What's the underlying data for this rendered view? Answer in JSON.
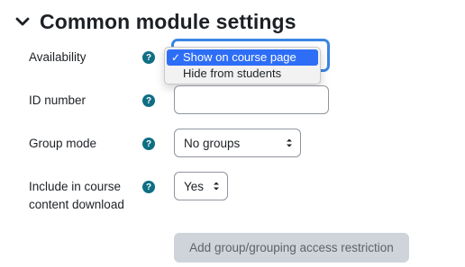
{
  "section": {
    "title": "Common module settings"
  },
  "availability": {
    "label": "Availability",
    "options": [
      "Show on course page",
      "Hide from students"
    ],
    "selected": "Show on course page",
    "check": "✓"
  },
  "idnumber": {
    "label": "ID number",
    "value": ""
  },
  "groupmode": {
    "label": "Group mode",
    "value": "No groups"
  },
  "download": {
    "label_line1": "Include in course",
    "label_line2": "content download",
    "value": "Yes"
  },
  "help_glyph": "?",
  "restriction_button": {
    "label": "Add group/grouping access restriction"
  },
  "colors": {
    "help": "#0f6e84",
    "focus": "#3a86e2",
    "selected_option": "#2e6ef7",
    "disabled_button": "#ced4da"
  }
}
